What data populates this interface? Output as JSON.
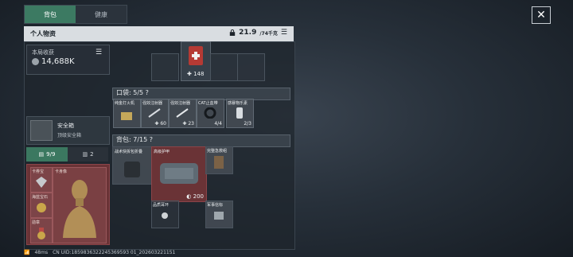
{
  "tabs": [
    {
      "label": "背包",
      "active": true
    },
    {
      "label": "健康",
      "active": false
    }
  ],
  "header": {
    "title": "个人物资",
    "capacity": "21.9",
    "capacity_unit": "/74千克"
  },
  "income": {
    "label": "本局收获",
    "value": "14,688K"
  },
  "safe": {
    "name": "安全箱",
    "subtitle": "顶级安全箱"
  },
  "counts": {
    "primary": "9/9",
    "secondary": "2"
  },
  "slots": {
    "item1": "卡券宝",
    "item2": "卡身像",
    "item3": "海蓝宝石",
    "item4": "勋章"
  },
  "equip": {
    "medkit_count": "148"
  },
  "pocket": {
    "title": "口袋: 5/5 ?",
    "items": [
      {
        "name": "纯金打火机",
        "count": ""
      },
      {
        "name": "强效注射器",
        "count": "60"
      },
      {
        "name": "强效注射器",
        "count": "23"
      },
      {
        "name": "CAT止血带",
        "count": "4/4"
      },
      {
        "name": "感暴物乐素",
        "count": "2/3"
      }
    ]
  },
  "backpack": {
    "title": "背包: 7/15 ?",
    "items": [
      {
        "name": "战术快拆包折叠"
      },
      {
        "name": "高级护甲",
        "count": "200"
      },
      {
        "name": "完整急救组"
      },
      {
        "name": "品质耳环"
      },
      {
        "name": "军事信标"
      }
    ]
  },
  "status": {
    "ping": "48ms",
    "uid": "CN UID:1859836322245369593 01_202603221151"
  },
  "colors": {
    "accent": "#3c7a62",
    "slot_red": "#6a3336"
  }
}
